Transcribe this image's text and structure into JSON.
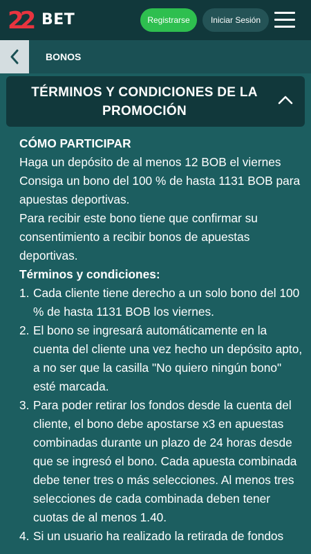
{
  "header": {
    "logo_badge": "22",
    "logo_text": "BET",
    "register_label": "Registrarse",
    "login_label": "Iniciar Sesión"
  },
  "subnav": {
    "title": "BONOS"
  },
  "accordion": {
    "title": "TÉRMINOS Y CONDICIONES DE LA PROMOCIÓN"
  },
  "content": {
    "how_heading": "CÓMO PARTICIPAR",
    "intro_1": "Haga un depósito de al menos 12 BOB el viernes",
    "intro_2": "Consiga un bono del 100 % de hasta 1131 BOB para apuestas deportivas.",
    "intro_3": "Para recibir este bono tiene que confirmar su consentimiento a recibir bonos de apuestas deportivas.",
    "terms_heading": "Términos y condiciones:",
    "terms": [
      {
        "num": "1.",
        "text": "Cada cliente tiene derecho a un solo bono del 100 % de hasta 1131 BOB los viernes."
      },
      {
        "num": "2.",
        "text": "El bono se ingresará automáticamente en la cuenta del cliente una vez hecho un depósito apto, a no ser que la casilla \"No quiero ningún bono\" esté marcada."
      },
      {
        "num": "3.",
        "text": "Para poder retirar los fondos desde la cuenta del cliente, el bono debe apostarse x3 en apuestas combinadas durante un plazo de 24 horas desde que se ingresó el bono. Cada apuesta combinada debe tener tres o más selecciones. Al menos tres selecciones de cada combinada deben tener cuotas de al menos 1.40."
      },
      {
        "num": "4.",
        "text": "Si un usuario ha realizado la retirada de fondos"
      }
    ]
  },
  "colors": {
    "background": "#1c5e60",
    "topbar": "#11383b",
    "register": "#2ebf4f",
    "logo_red": "#e8343f"
  },
  "icons": [
    "logo-22-badge",
    "hamburger-menu-icon",
    "chevron-left-icon",
    "chevron-up-icon"
  ]
}
